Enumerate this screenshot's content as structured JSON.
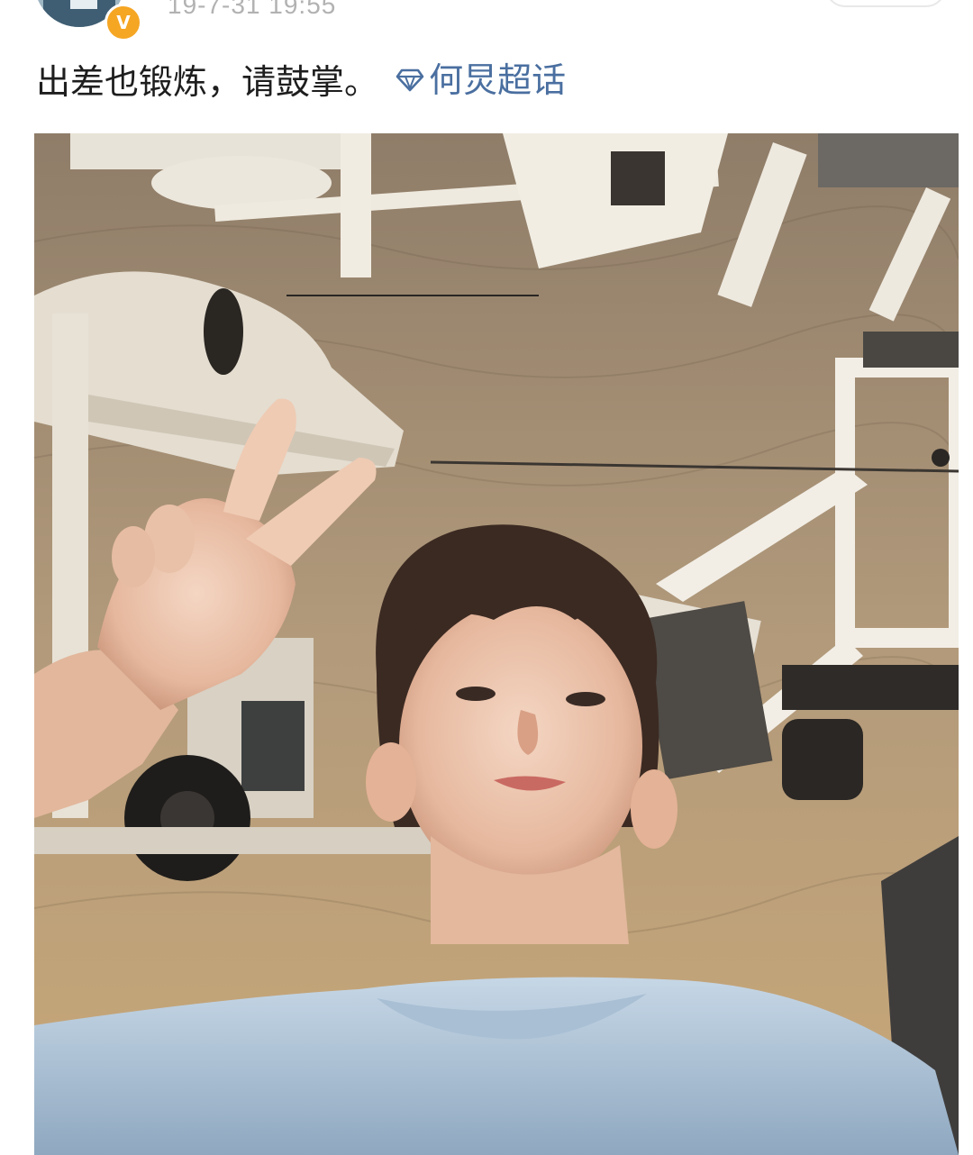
{
  "header": {
    "timestamp": "19-7-31 19:55",
    "verified_badge": "V"
  },
  "post": {
    "text": "出差也锻炼，请鼓掌。",
    "topic_label": "何炅超话",
    "topic_icon": "diamond-icon"
  },
  "colors": {
    "topic": "#4a6fa0",
    "badge": "#f5a623",
    "timestamp": "#b2b2b2",
    "text": "#1e1e1e"
  }
}
